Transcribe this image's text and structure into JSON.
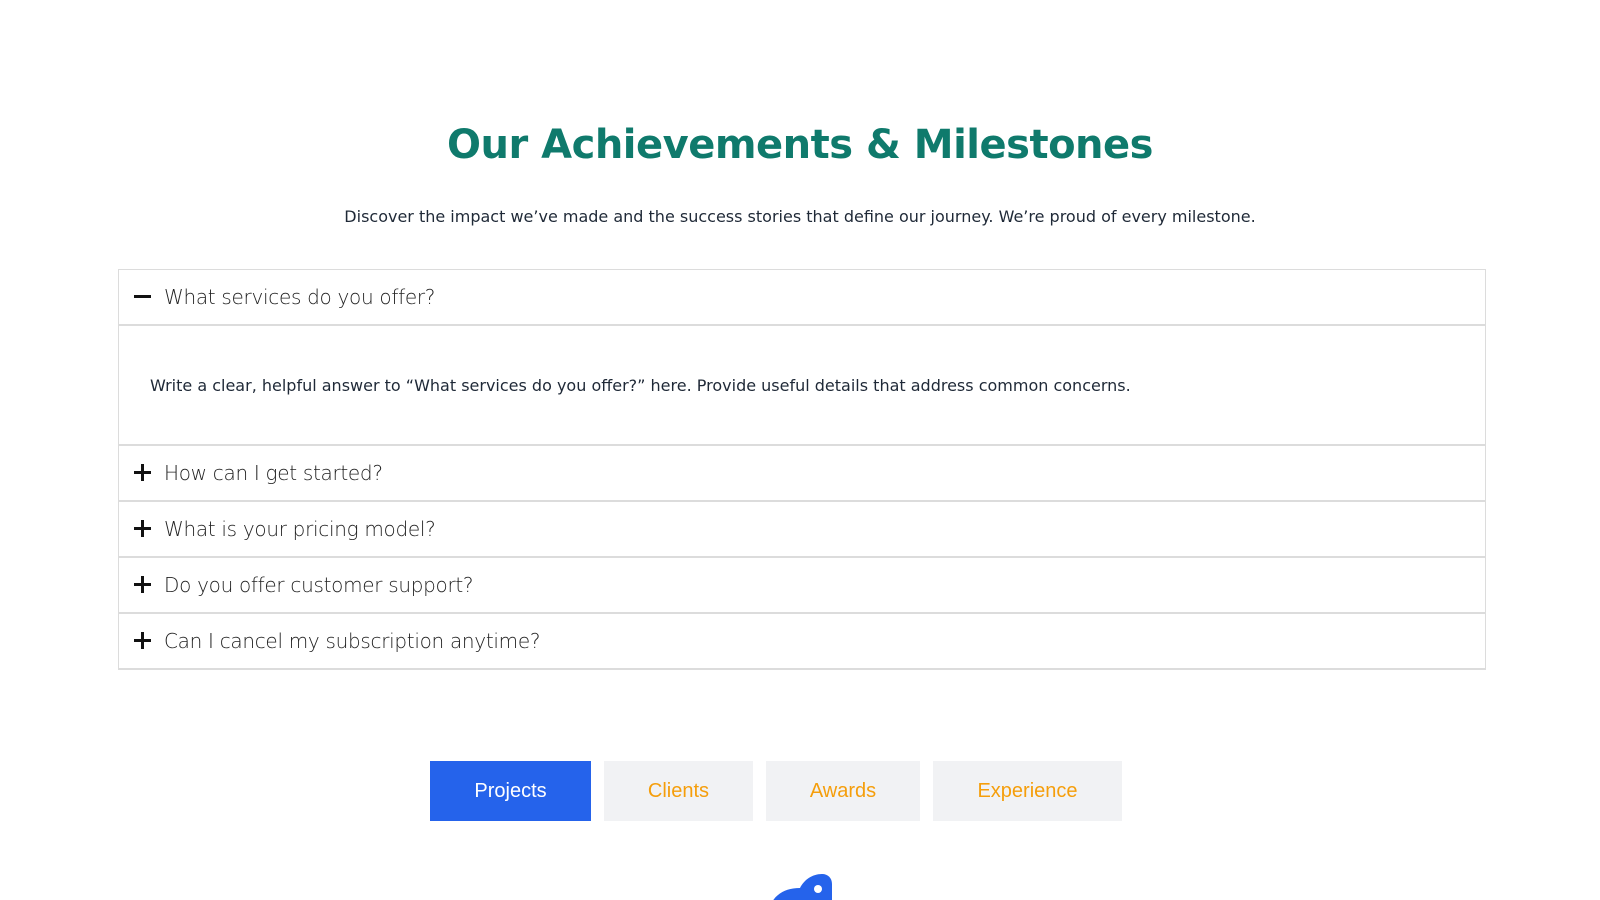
{
  "header": {
    "title": "Our Achievements & Milestones",
    "subtitle": "Discover the impact we’ve made and the success stories that define our journey. We’re proud of every milestone."
  },
  "faq": {
    "items": [
      {
        "question": "What services do you offer?",
        "expanded": true,
        "answer": "Write a clear, helpful answer to “What services do you offer?” here. Provide useful details that address common concerns."
      },
      {
        "question": "How can I get started?",
        "expanded": false
      },
      {
        "question": "What is your pricing model?",
        "expanded": false
      },
      {
        "question": "Do you offer customer support?",
        "expanded": false
      },
      {
        "question": "Can I cancel my subscription anytime?",
        "expanded": false
      }
    ],
    "icons": {
      "expanded": "minus-icon",
      "collapsed": "plus-icon"
    }
  },
  "tabs": {
    "items": [
      {
        "label": "Projects",
        "active": true
      },
      {
        "label": "Clients",
        "active": false
      },
      {
        "label": "Awards",
        "active": false
      },
      {
        "label": "Experience",
        "active": false
      }
    ]
  },
  "colors": {
    "title": "#0f7a6c",
    "tab_active_bg": "#2563eb",
    "tab_inactive_text": "#f59e0b",
    "tab_inactive_bg": "#f1f2f4",
    "logo": "#2563eb"
  },
  "logo": {
    "icon": "bird-logo-icon"
  }
}
